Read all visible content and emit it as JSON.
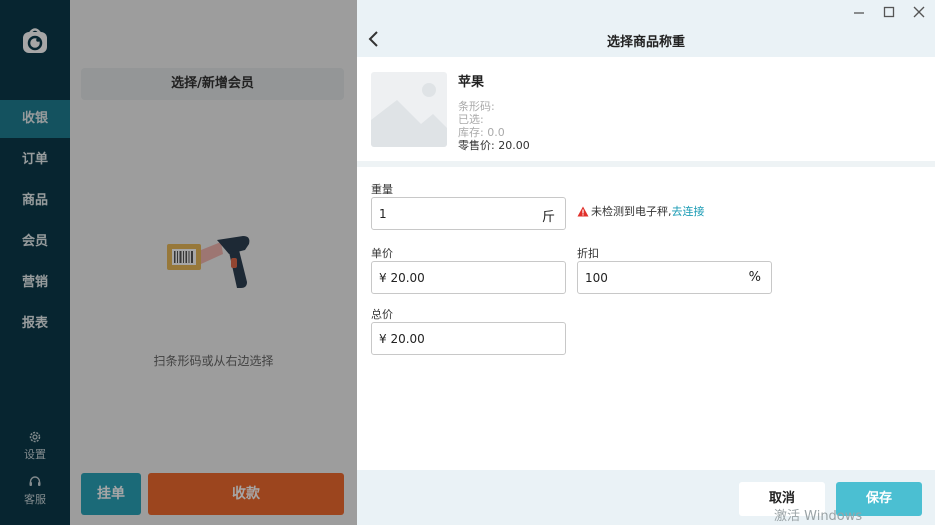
{
  "sidebar": {
    "items": [
      {
        "label": "收银",
        "active": true
      },
      {
        "label": "订单"
      },
      {
        "label": "商品"
      },
      {
        "label": "会员"
      },
      {
        "label": "营销"
      },
      {
        "label": "报表"
      }
    ],
    "settings_label": "设置",
    "service_label": "客服"
  },
  "main": {
    "member_button": "选择/新增会员",
    "scan_hint": "扫条形码或从右边选择",
    "hold_button": "挂单",
    "checkout_button": "收款"
  },
  "panel": {
    "title": "选择商品称重",
    "product": {
      "name": "苹果",
      "barcode_label": "条形码:",
      "selected_label": "已选:",
      "stock_label": "库存: 0.0",
      "price_label": "零售价: 20.00"
    },
    "weight": {
      "label": "重量",
      "value": "1",
      "unit": "斤"
    },
    "warning": {
      "text": "未检测到电子秤,",
      "link": "去连接"
    },
    "unit_price": {
      "label": "单价",
      "value": "¥ 20.00"
    },
    "discount": {
      "label": "折扣",
      "value": "100",
      "unit": "%"
    },
    "total": {
      "label": "总价",
      "value": "¥ 20.00"
    },
    "cancel_button": "取消",
    "save_button": "保存"
  },
  "watermark": "激活 Windows",
  "colors": {
    "sidebar_bg": "#0c3a4a",
    "sidebar_active": "#1f7e92",
    "accent": "#4bbfd2",
    "checkout": "#f06a2e",
    "hold": "#2aa3b8",
    "link": "#1a9bb4",
    "warning": "#e0302a"
  }
}
